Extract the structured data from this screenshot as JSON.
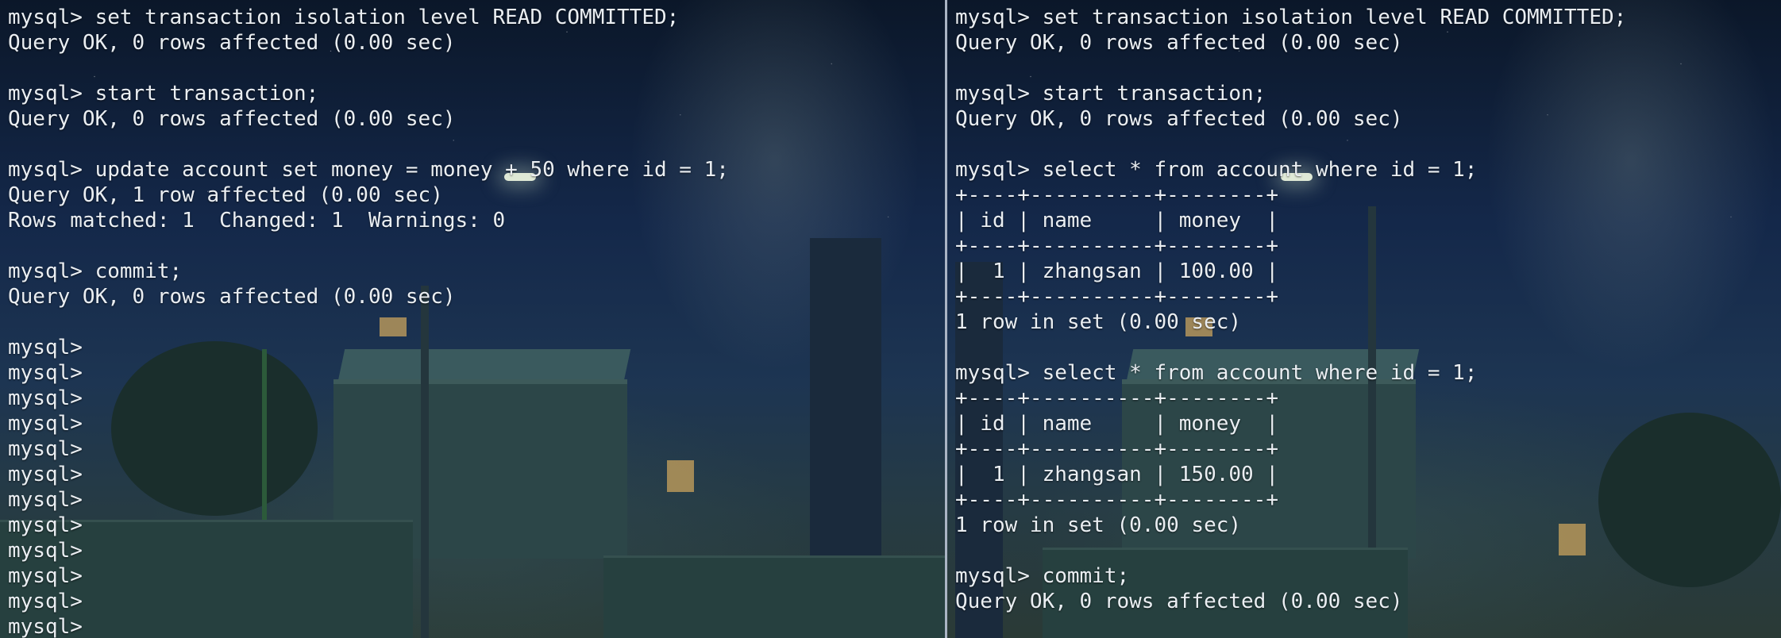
{
  "left_terminal": {
    "lines": [
      "mysql> set transaction isolation level READ COMMITTED;",
      "Query OK, 0 rows affected (0.00 sec)",
      "",
      "mysql> start transaction;",
      "Query OK, 0 rows affected (0.00 sec)",
      "",
      "mysql> update account set money = money + 50 where id = 1;",
      "Query OK, 1 row affected (0.00 sec)",
      "Rows matched: 1  Changed: 1  Warnings: 0",
      "",
      "mysql> commit;",
      "Query OK, 0 rows affected (0.00 sec)",
      "",
      "mysql>",
      "mysql>",
      "mysql>",
      "mysql>",
      "mysql>",
      "mysql>",
      "mysql>",
      "mysql>",
      "mysql>",
      "mysql>",
      "mysql>",
      "mysql>"
    ]
  },
  "right_terminal": {
    "lines": [
      "mysql> set transaction isolation level READ COMMITTED;",
      "Query OK, 0 rows affected (0.00 sec)",
      "",
      "mysql> start transaction;",
      "Query OK, 0 rows affected (0.00 sec)",
      "",
      "mysql> select * from account where id = 1;",
      "+----+----------+--------+",
      "| id | name     | money  |",
      "+----+----------+--------+",
      "|  1 | zhangsan | 100.00 |",
      "+----+----------+--------+",
      "1 row in set (0.00 sec)",
      "",
      "mysql> select * from account where id = 1;",
      "+----+----------+--------+",
      "| id | name     | money  |",
      "+----+----------+--------+",
      "|  1 | zhangsan | 150.00 |",
      "+----+----------+--------+",
      "1 row in set (0.00 sec)",
      "",
      "mysql> commit;",
      "Query OK, 0 rows affected (0.00 sec)"
    ]
  },
  "theme": {
    "text_color": "#eaeef2",
    "divider_color": "#aab4c4",
    "wallpaper": "night-street-scene"
  }
}
